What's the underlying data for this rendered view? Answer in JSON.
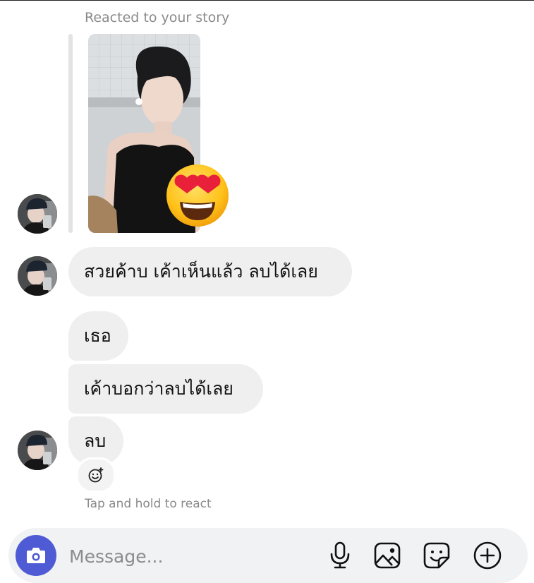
{
  "story": {
    "reacted_label": "Reacted to your story",
    "reaction_emoji": "heart-eyes-emoji"
  },
  "messages": [
    {
      "text": "สวยค้าบ เค้าเห็นแล้ว ลบได้เลย"
    },
    {
      "text": "เธอ"
    },
    {
      "text": "เค้าบอกว่าลบได้เลย"
    },
    {
      "text": "ลบ"
    }
  ],
  "react_hint": "Tap and hold to react",
  "composer": {
    "placeholder": "Message...",
    "icons": [
      "camera-icon",
      "microphone-icon",
      "gallery-icon",
      "sticker-icon",
      "plus-circle-icon"
    ]
  },
  "colors": {
    "camera_button": "#4f5bd5",
    "bubble": "#efefef",
    "secondary_text": "#8a8a8a"
  }
}
